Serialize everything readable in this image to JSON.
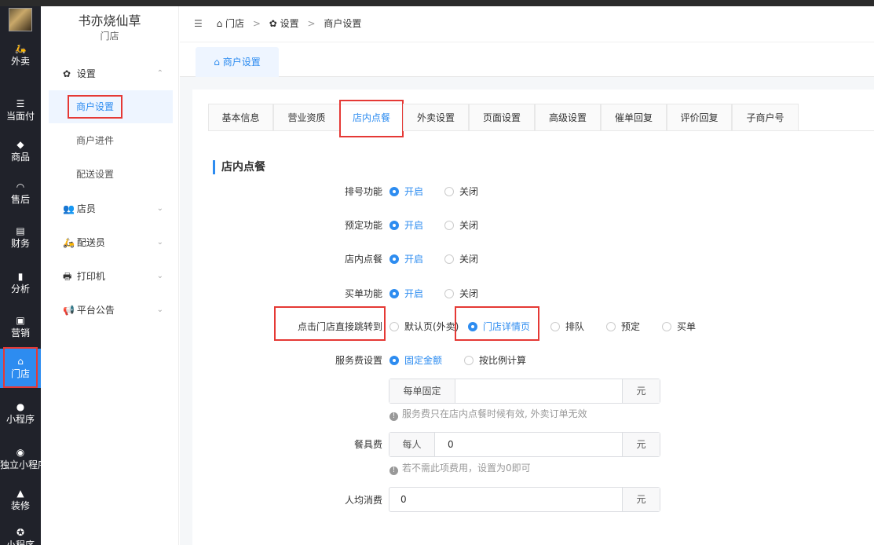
{
  "rail": {
    "items": [
      {
        "icon": "moped-icon",
        "glyph": "🛵",
        "label": "外卖"
      },
      {
        "icon": "list-icon",
        "glyph": "☰",
        "label": "当面付"
      },
      {
        "icon": "bag-icon",
        "glyph": "◆",
        "label": "商品"
      },
      {
        "icon": "headset-icon",
        "glyph": "◠",
        "label": "售后"
      },
      {
        "icon": "ledger-icon",
        "glyph": "▤",
        "label": "财务"
      },
      {
        "icon": "bar-chart-icon",
        "glyph": "▮",
        "label": "分析"
      },
      {
        "icon": "gift-icon",
        "glyph": "▣",
        "label": "营销"
      },
      {
        "icon": "store-icon",
        "glyph": "⌂",
        "label": "门店"
      },
      {
        "icon": "wechat-icon",
        "glyph": "●",
        "label": "小程序"
      },
      {
        "icon": "link-icon",
        "glyph": "◉",
        "label": "独立小程序"
      },
      {
        "icon": "decorate-icon",
        "glyph": "▲",
        "label": "装修"
      },
      {
        "icon": "plugin-icon",
        "glyph": "✪",
        "label": "小程序"
      }
    ]
  },
  "sidebar": {
    "brand_name": "书亦烧仙草",
    "brand_sub": "门店",
    "groups": [
      {
        "label": "设置",
        "icon": "gear-icon",
        "glyph": "✿",
        "chevron": "⌃"
      },
      {
        "label": "店员",
        "icon": "staff-icon",
        "glyph": "👥",
        "chevron": "⌄"
      },
      {
        "label": "配送员",
        "icon": "rider-icon",
        "glyph": "🛵",
        "chevron": "⌄"
      },
      {
        "label": "打印机",
        "icon": "printer-icon",
        "glyph": "🖶",
        "chevron": "⌄"
      },
      {
        "label": "平台公告",
        "icon": "announce-icon",
        "glyph": "📢",
        "chevron": "⌄"
      }
    ],
    "settings_sub": [
      "商户设置",
      "商户进件",
      "配送设置"
    ]
  },
  "header": {
    "breadcrumb": [
      "门店",
      "设置",
      "商户设置"
    ],
    "breadcrumb_sep": ">"
  },
  "tagbar": {
    "active_tag": "商户设置"
  },
  "tabs": [
    "基本信息",
    "营业资质",
    "店内点餐",
    "外卖设置",
    "页面设置",
    "高级设置",
    "催单回复",
    "评价回复",
    "子商户号"
  ],
  "section_title": "店内点餐",
  "form": {
    "queue": {
      "label": "排号功能",
      "on": "开启",
      "off": "关闭"
    },
    "reserve": {
      "label": "预定功能",
      "on": "开启",
      "off": "关闭"
    },
    "dine_in": {
      "label": "店内点餐",
      "on": "开启",
      "off": "关闭"
    },
    "checkout": {
      "label": "买单功能",
      "on": "开启",
      "off": "关闭"
    },
    "jump": {
      "label": "点击门店直接跳转到",
      "options": [
        "默认页(外卖)",
        "门店详情页",
        "排队",
        "预定",
        "买单"
      ],
      "selected": "门店详情页"
    },
    "service_fee": {
      "label": "服务费设置",
      "options": [
        "固定金额",
        "按比例计算"
      ],
      "selected": "固定金额",
      "prefix": "每单固定",
      "value": "",
      "suffix": "元",
      "hint": "服务费只在店内点餐时候有效, 外卖订单无效"
    },
    "tableware": {
      "label": "餐具费",
      "prefix": "每人",
      "value": "0",
      "suffix": "元",
      "hint": "若不需此项费用，设置为0即可"
    },
    "avg_spend": {
      "label": "人均消费",
      "value": "0",
      "suffix": "元"
    }
  },
  "colors": {
    "accent": "#2d8cf0",
    "highlight": "#e53935",
    "rail_bg": "#20222a"
  }
}
